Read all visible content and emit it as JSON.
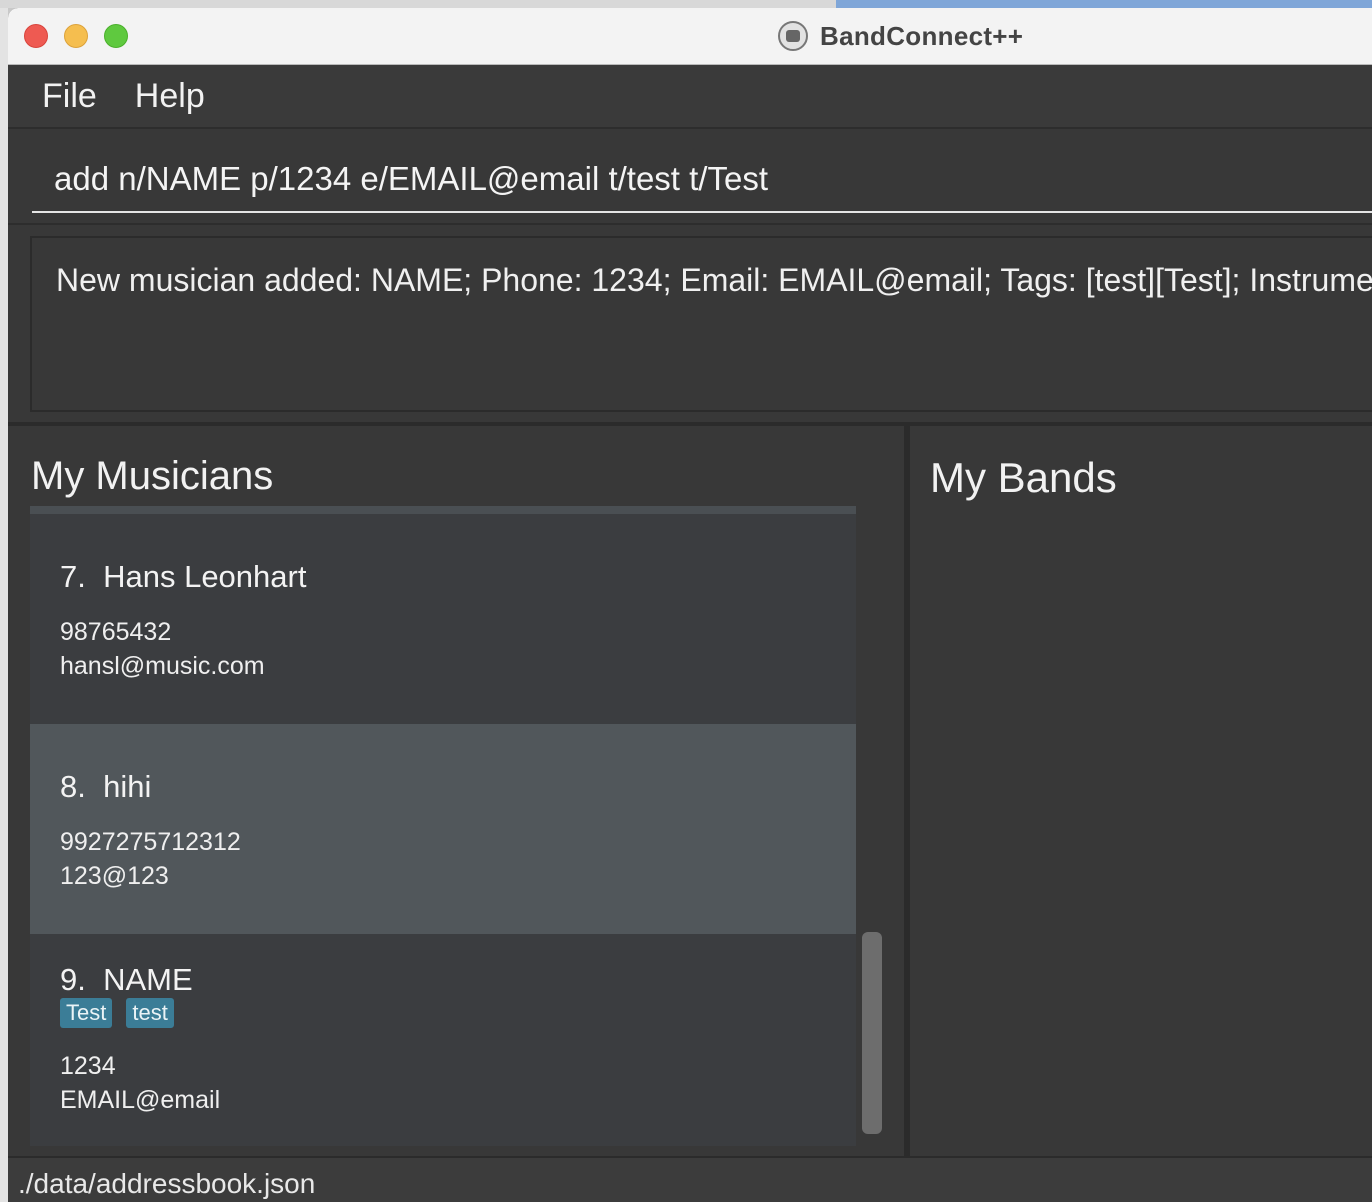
{
  "window": {
    "title": "BandConnect++"
  },
  "menu": {
    "items": [
      "File",
      "Help"
    ]
  },
  "command": {
    "value": "add n/NAME p/1234 e/EMAIL@email t/test t/Test"
  },
  "result": {
    "text": "New musician added: NAME; Phone: 1234; Email: EMAIL@email; Tags: [test][Test]; Instrume"
  },
  "musicians": {
    "title": "My Musicians",
    "cards": [
      {
        "index": "7.",
        "name": "Hans Leonhart",
        "phone": "98765432",
        "email": "hansl@music.com",
        "tags": []
      },
      {
        "index": "8.",
        "name": "hihi",
        "phone": "9927275712312",
        "email": "123@123",
        "tags": []
      },
      {
        "index": "9.",
        "name": "NAME",
        "phone": "1234",
        "email": "EMAIL@email",
        "tags": [
          "Test",
          "test"
        ]
      }
    ]
  },
  "bands": {
    "title": "My Bands"
  },
  "status": {
    "path": "./data/addressbook.json"
  },
  "colors": {
    "background": "#383838",
    "selected_card": "#51575b",
    "tag": "#3b7d97",
    "close": "#ee5a52",
    "minimize": "#f5be4f",
    "maximize": "#5fc93f"
  }
}
